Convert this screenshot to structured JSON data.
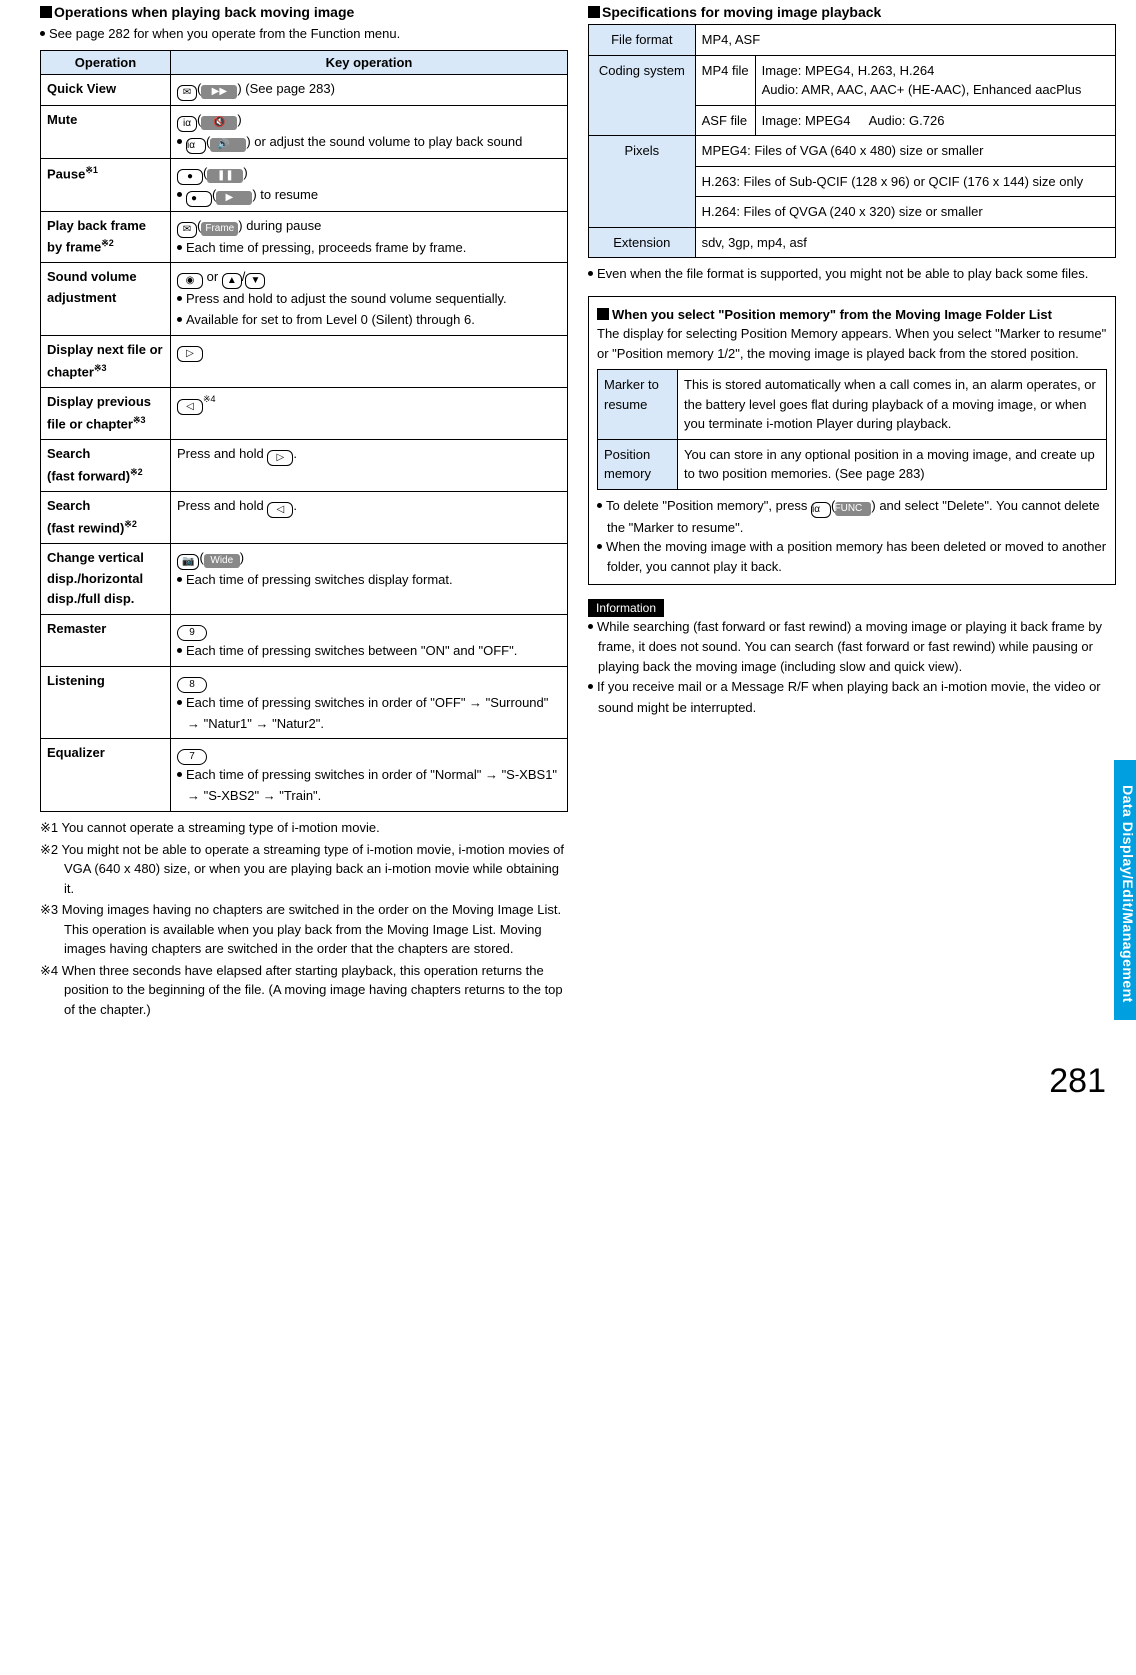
{
  "left": {
    "heading": "Operations when playing back moving image",
    "intro": "See page 282 for when you operate from the Function menu.",
    "th_op": "Operation",
    "th_key": "Key operation",
    "rows": {
      "quick_view": {
        "op": "Quick View",
        "note": ") (See page 283)"
      },
      "mute": {
        "op": "Mute",
        "line2": ") or adjust the sound volume to play back sound"
      },
      "pause": {
        "op": "Pause",
        "sup": "※1",
        "line2": ") to resume"
      },
      "frame": {
        "op": "Play back frame by frame",
        "sup": "※2",
        "btn": "Frame",
        "line1_suffix": ") during pause",
        "line2": "Each time of pressing, proceeds frame by frame."
      },
      "volume": {
        "op": "Sound volume adjustment",
        "line1_suffix": " or ",
        "line2": "Press and hold to adjust the sound volume sequentially.",
        "line3": "Available for set to from Level 0 (Silent) through 6."
      },
      "next": {
        "op": "Display next file or chapter",
        "sup": "※3"
      },
      "prev": {
        "op": "Display previous file or chapter",
        "sup": "※3",
        "ksup": "※4"
      },
      "ff": {
        "op": "Search\n(fast forward)",
        "sup": "※2",
        "line": "Press and hold "
      },
      "rw": {
        "op": "Search\n(fast rewind)",
        "sup": "※2",
        "line": "Press and hold "
      },
      "disp": {
        "op": "Change vertical disp./horizontal disp./full disp.",
        "btn": "Wide",
        "line2": "Each time of pressing switches display format."
      },
      "remaster": {
        "op": "Remaster",
        "key": "9",
        "line2": "Each time of pressing switches between \"ON\" and \"OFF\"."
      },
      "listening": {
        "op": "Listening",
        "key": "8",
        "line2": "Each time of pressing switches in order of \"OFF\" → \"Surround\" → \"Natur1\" → \"Natur2\"."
      },
      "eq": {
        "op": "Equalizer",
        "key": "7",
        "line2": "Each time of pressing switches in order of \"Normal\" → \"S-XBS1\" → \"S-XBS2\" → \"Train\"."
      }
    },
    "notes": {
      "n1": "※1 You cannot operate a streaming type of i-motion movie.",
      "n2": "※2 You might not be able to operate a streaming type of i-motion movie, i-motion movies of VGA (640 x 480) size, or when you are playing back an i-motion movie while obtaining it.",
      "n3": "※3 Moving images having no chapters are switched in the order on the Moving Image List. This operation is available when you play back from the Moving Image List. Moving images having chapters are switched in the order that the chapters are stored.",
      "n4": "※4 When three seconds have elapsed after starting playback, this operation returns the position to the beginning of the file. (A moving image having chapters returns to the top of the chapter.)"
    }
  },
  "right": {
    "heading": "Specifications for moving image playback",
    "spec": {
      "file_format_h": "File format",
      "file_format": "MP4, ASF",
      "coding_h": "Coding system",
      "mp4file": "MP4 file",
      "mp4_img": "Image: MPEG4, H.263, H.264",
      "mp4_aud": "Audio: AMR, AAC, AAC+ (HE-AAC), Enhanced aacPlus",
      "asffile": "ASF file",
      "asf_img": "Image: MPEG4",
      "asf_aud": "Audio: G.726",
      "pixels_h": "Pixels",
      "px1": "MPEG4: Files of VGA (640 x 480) size or smaller",
      "px2": "H.263: Files of Sub-QCIF (128 x 96) or QCIF (176 x 144) size only",
      "px3": "H.264: Files of QVGA (240 x 320) size or smaller",
      "ext_h": "Extension",
      "ext": "sdv, 3gp, mp4, asf"
    },
    "spec_note": "Even when the file format is supported, you might not be able to play back some files.",
    "box": {
      "title": "When you select \"Position memory\" from the Moving Image Folder List",
      "body": "The display for selecting Position Memory appears. When you select \"Marker to resume\" or \"Position memory 1/2\", the moving image is played back from the stored position.",
      "marker_h": "Marker to resume",
      "marker": "This is stored automatically when a call comes in, an alarm operates, or the battery level goes flat during playback of a moving image, or when you terminate i-motion Player during playback.",
      "pos_h": "Position memory",
      "pos": "You can store in any optional position in a moving image, and create up to two position memories. (See page 283)",
      "del1a": "To delete \"Position memory\", press ",
      "del_btn": "FUNC",
      "del1b": ") and select \"Delete\". You cannot delete the \"Marker to resume\".",
      "del2": "When the moving image with a position memory has been deleted or moved to another folder, you cannot play it back."
    },
    "info_h": "Information",
    "info1": "While searching (fast forward or fast rewind) a moving image or playing it back frame by frame, it does not sound. You can search (fast forward or fast rewind) while pausing or playing back the moving image (including slow and quick view).",
    "info2": "If you receive mail or a Message R/F when playing back an i-motion movie, the video or sound might be interrupted."
  },
  "side_tab": "Data Display/Edit/Management",
  "page_num": "281"
}
